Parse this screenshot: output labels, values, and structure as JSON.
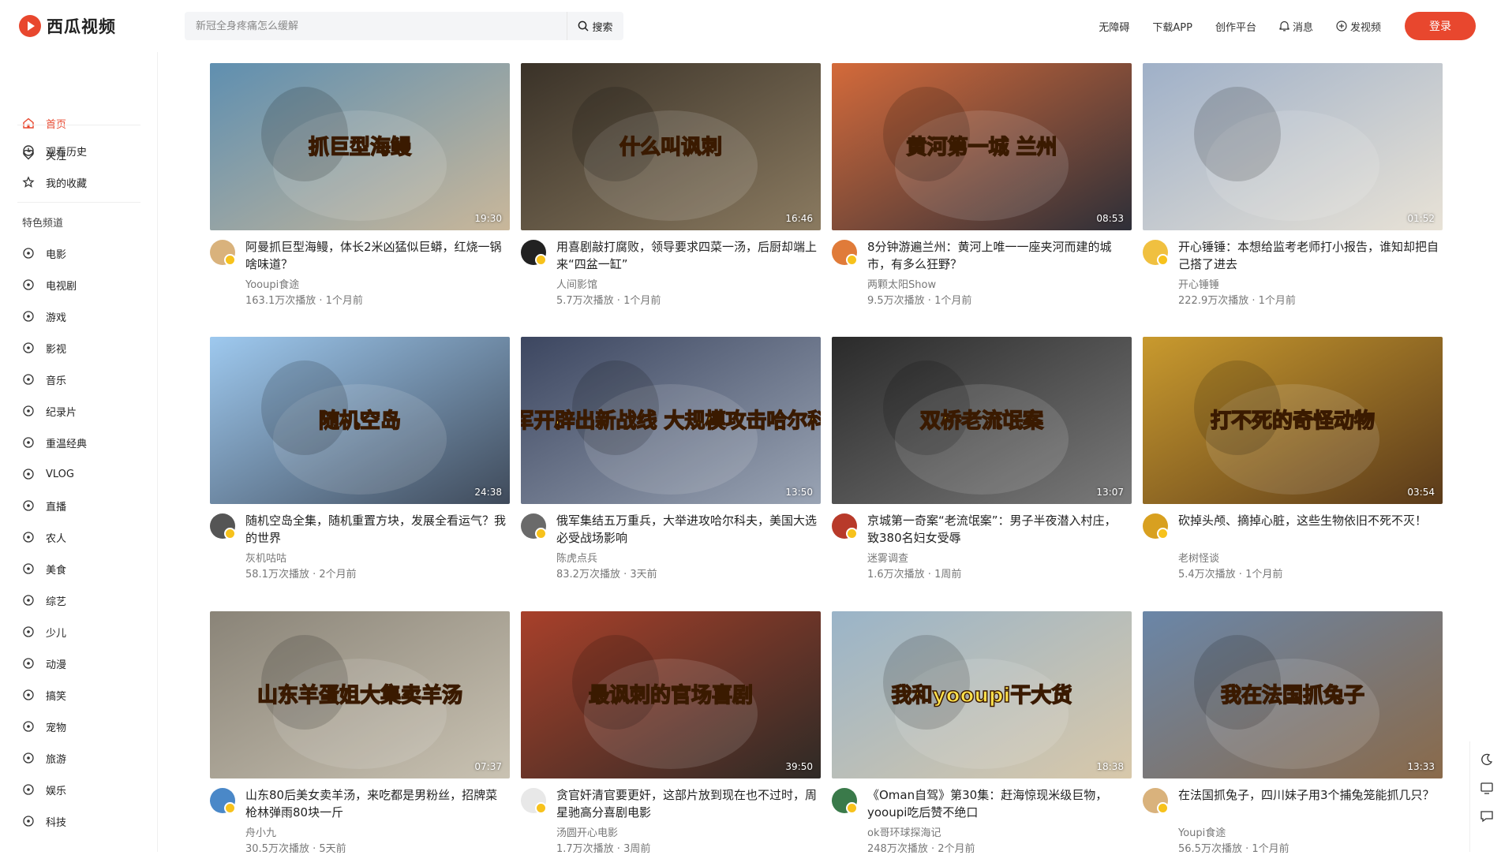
{
  "app": {
    "brand": "西瓜视频",
    "accent": "#e8472e"
  },
  "search": {
    "placeholder": "新冠全身疼痛怎么缓解",
    "button": "搜索"
  },
  "top_links": {
    "accessibility": "无障碍",
    "download": "下载APP",
    "creator": "创作平台",
    "messages": "消息",
    "upload": "发视频",
    "login": "登录"
  },
  "sidebar": {
    "primary": [
      {
        "label": "首页",
        "icon": "home-icon",
        "active": true
      },
      {
        "label": "关注",
        "icon": "heart-icon"
      }
    ],
    "personal": [
      {
        "label": "观看历史",
        "icon": "clock-icon"
      },
      {
        "label": "我的收藏",
        "icon": "star-icon"
      }
    ],
    "channels_heading": "特色频道",
    "channels": [
      {
        "label": "电影",
        "icon": "film-icon"
      },
      {
        "label": "电视剧",
        "icon": "tv-icon"
      },
      {
        "label": "游戏",
        "icon": "gamepad-icon"
      },
      {
        "label": "影视",
        "icon": "clapper-icon"
      },
      {
        "label": "音乐",
        "icon": "music-icon"
      },
      {
        "label": "纪录片",
        "icon": "document-icon"
      },
      {
        "label": "重温经典",
        "icon": "flag-icon"
      },
      {
        "label": "VLOG",
        "icon": "camera-icon"
      },
      {
        "label": "直播",
        "icon": "live-icon"
      },
      {
        "label": "农人",
        "icon": "farmer-icon"
      },
      {
        "label": "美食",
        "icon": "food-icon"
      },
      {
        "label": "综艺",
        "icon": "variety-icon"
      },
      {
        "label": "少儿",
        "icon": "kids-icon"
      },
      {
        "label": "动漫",
        "icon": "anime-icon"
      },
      {
        "label": "搞笑",
        "icon": "smile-icon"
      },
      {
        "label": "宠物",
        "icon": "pet-icon"
      },
      {
        "label": "旅游",
        "icon": "luggage-icon"
      },
      {
        "label": "娱乐",
        "icon": "entertainment-icon"
      },
      {
        "label": "科技",
        "icon": "tech-icon"
      }
    ]
  },
  "videos": [
    {
      "title": "阿曼抓巨型海鳗，体长2米凶猛似巨蟒，红烧一锅啥味道？",
      "author": "Yooupi食途",
      "stats": "163.1万次播放 · 1个月前",
      "duration": "19:30",
      "overlay": "抓巨型海鳗",
      "colors": [
        "#5f8fb0",
        "#c9b79a"
      ],
      "avatar": "#d9b27c"
    },
    {
      "title": "用喜剧敲打腐败，领导要求四菜一汤，后厨却端上来“四盆一缸”",
      "author": "人间影馆",
      "stats": "5.7万次播放 · 1个月前",
      "duration": "16:46",
      "overlay": "什么叫讽刺",
      "colors": [
        "#3a3228",
        "#8a7a60"
      ],
      "avatar": "#222222"
    },
    {
      "title": "8分钟游遍兰州：黄河上唯一一座夹河而建的城市，有多么狂野？",
      "author": "两颗太阳Show",
      "stats": "9.5万次播放 · 1个月前",
      "duration": "08:53",
      "overlay": "黄河第一城 兰州",
      "colors": [
        "#d46a3a",
        "#2e2f38"
      ],
      "avatar": "#e07b39"
    },
    {
      "title": "开心锤锤：本想给监考老师打小报告，谁知却把自己搭了进去",
      "author": "开心锤锤",
      "stats": "222.9万次播放 · 1个月前",
      "duration": "01:52",
      "overlay": "",
      "colors": [
        "#9fb0c8",
        "#e8e2d6"
      ],
      "avatar": "#f0c040"
    },
    {
      "title": "随机空岛全集，随机重置方块，发展全看运气？我的世界",
      "author": "灰机咕咕",
      "stats": "58.1万次播放 · 2个月前",
      "duration": "24:38",
      "overlay": "随机空岛",
      "colors": [
        "#9ec9ef",
        "#3f4a5a"
      ],
      "avatar": "#555555"
    },
    {
      "title": "俄军集结五万重兵，大举进攻哈尔科夫，美国大选必受战场影响",
      "author": "陈虎点兵",
      "stats": "83.2万次播放 · 3天前",
      "duration": "13:50",
      "overlay": "俄军开辟出新战线 大规模攻击哈尔科夫",
      "colors": [
        "#3c4660",
        "#9aa4b4"
      ],
      "avatar": "#6a6a6a"
    },
    {
      "title": "京城第一奇案“老流氓案”：男子半夜潜入村庄，致380名妇女受辱",
      "author": "迷雾调查",
      "stats": "1.6万次播放 · 1周前",
      "duration": "13:07",
      "overlay": "双桥老流氓案",
      "colors": [
        "#2a2a2a",
        "#7a7a7a"
      ],
      "avatar": "#b83a2a"
    },
    {
      "title": "砍掉头颅、摘掉心脏，这些生物依旧不死不灭！",
      "author": "老树怪谈",
      "stats": "5.4万次播放 · 1个月前",
      "duration": "03:54",
      "overlay": "打不死的奇怪动物",
      "colors": [
        "#c99a2e",
        "#5a3a1a"
      ],
      "avatar": "#d8a020"
    },
    {
      "title": "山东80后美女卖羊汤，来吃都是男粉丝，招牌菜枪林弹雨80块一斤",
      "author": "舟小九",
      "stats": "30.5万次播放 · 5天前",
      "duration": "07:37",
      "overlay": "山东羊蛋姐大集卖羊汤",
      "colors": [
        "#8a8478",
        "#c9c2b2"
      ],
      "avatar": "#4a88c8"
    },
    {
      "title": "贪官奸清官要更奸，这部片放到现在也不过时，周星驰高分喜剧电影",
      "author": "汤圆开心电影",
      "stats": "1.7万次播放 · 3周前",
      "duration": "39:50",
      "overlay": "最讽刺的官场喜剧",
      "colors": [
        "#a8402a",
        "#2e2a26"
      ],
      "avatar": "#e8e8e8"
    },
    {
      "title": "《Oman自驾》第30集：赶海惊现米级巨物，yooupi吃后赞不绝口",
      "author": "ok哥环球探海记",
      "stats": "248万次播放 · 2个月前",
      "duration": "18:38",
      "overlay": "我和yooupi干大货",
      "colors": [
        "#9ab4c8",
        "#d8c8aa"
      ],
      "avatar": "#3a7a4a"
    },
    {
      "title": "在法国抓兔子，四川妹子用3个捕兔笼能抓几只？",
      "author": "Youpi食途",
      "stats": "56.5万次播放 · 1个月前",
      "duration": "13:33",
      "overlay": "我在法国抓兔子",
      "colors": [
        "#6a86a8",
        "#8a6a4a"
      ],
      "avatar": "#d9b27c"
    }
  ]
}
